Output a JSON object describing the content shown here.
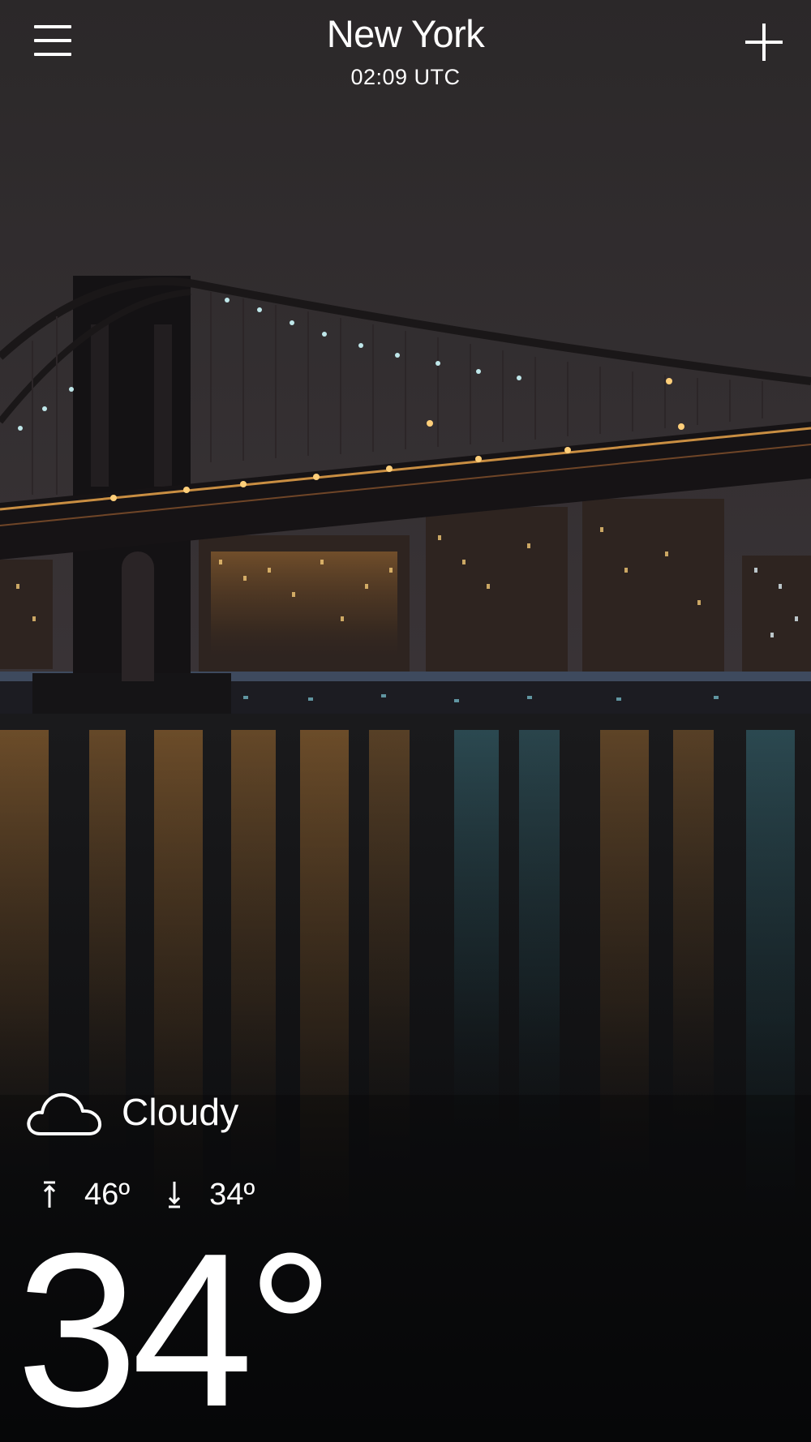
{
  "header": {
    "city": "New York",
    "time": "02:09 UTC",
    "menu_icon": "hamburger-menu-icon",
    "add_icon": "plus-icon"
  },
  "weather": {
    "condition": "Cloudy",
    "condition_icon": "cloud-icon",
    "high": "46º",
    "low": "34º",
    "current_temp": "34°"
  },
  "background": {
    "description_icon": "manhattan-bridge-night-photo",
    "colors": {
      "sky": "#2a2729",
      "water": "#0d0f12",
      "light_amber": "#e8a54a",
      "light_teal": "#5fb8c9"
    }
  }
}
